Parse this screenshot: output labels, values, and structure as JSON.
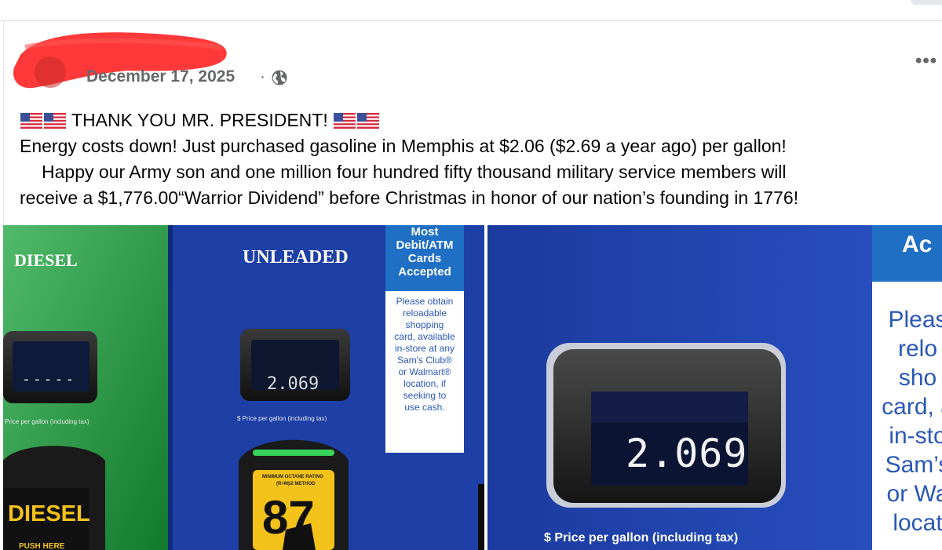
{
  "post": {
    "date": "December 17, 2025",
    "separator": "·",
    "more": "•••",
    "lines": [
      "THANK YOU MR. PRESIDENT!",
      "Energy costs down! Just purchased gasoline in Memphis at $2.06 ($2.69 a year ago) per gallon!",
      "Happy our Army son and one million four hundred fifty thousand military service members will",
      "receive a $1,776.00“Warrior Dividend” before Christmas in honor of our nation’s founding in 1776!"
    ]
  },
  "photo_left": {
    "diesel_label": "DIESEL",
    "unleaded_label": "UNLEADED",
    "diesel_display": "-----",
    "unleaded_display": "2.069",
    "price_caption": "Price per gallon (including tax)",
    "price_caption_unleaded": "$ Price per gallon (including tax)",
    "sticker_title": [
      "Most",
      "Debit/ATM",
      "Cards",
      "Accepted"
    ],
    "sticker_body": [
      "Please obtain",
      "reloadable",
      "shopping",
      "card, available",
      "in-store at any",
      "Sam's Club®",
      "or Walmart®",
      "location, if",
      "seeking to",
      "use cash."
    ],
    "nozzle_diesel": "DIESEL",
    "nozzle_diesel_sub": "PUSH HERE",
    "octane_caption": "MINIMUM OCTANE RATING",
    "octane_method": "(R+M)/2 METHOD",
    "octane": "87"
  },
  "photo_right": {
    "display": "2.069",
    "caption": "$ Price per gallon (including tax)",
    "sticker_head": "Ac",
    "sticker_body": [
      "Pleas",
      "relo",
      "sho",
      "card, a",
      "in-sto",
      "Sam’s",
      "or Wa",
      "locat"
    ]
  },
  "colors": {
    "diesel_green": "#17a33a",
    "pump_blue": "#1d3fa6",
    "date_gray": "#65676b",
    "redaction": "#ff2a2a"
  }
}
